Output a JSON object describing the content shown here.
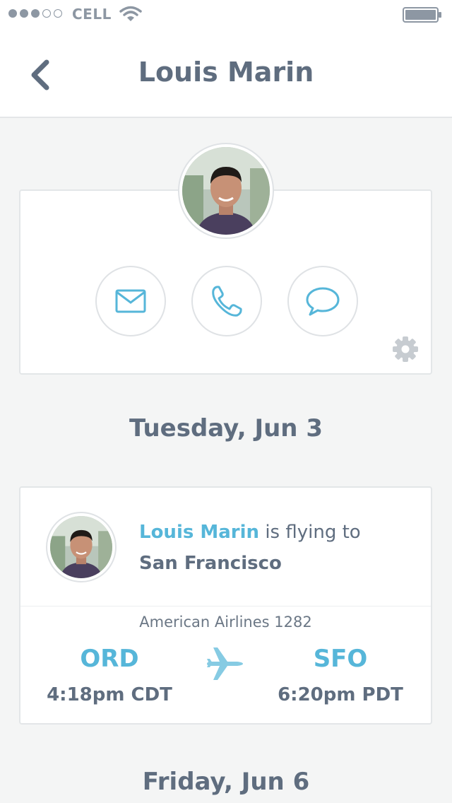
{
  "status_bar": {
    "carrier": "CELL",
    "signal_bars_filled": 3,
    "signal_bars_total": 5
  },
  "nav": {
    "title": "Louis Marin",
    "back_icon": "chevron-left-icon"
  },
  "profile": {
    "actions": [
      {
        "icon": "mail-icon"
      },
      {
        "icon": "phone-icon"
      },
      {
        "icon": "chat-icon"
      }
    ],
    "settings_icon": "gear-icon"
  },
  "days": [
    {
      "heading": "Tuesday, Jun 3",
      "event": {
        "person": "Louis Marin",
        "verb": "is flying to",
        "destination": "San Francisco",
        "airline": "American Airlines 1282",
        "origin_code": "ORD",
        "origin_time": "4:18pm CDT",
        "dest_code": "SFO",
        "dest_time": "6:20pm PDT"
      }
    },
    {
      "heading": "Friday, Jun 6"
    }
  ],
  "colors": {
    "accent": "#56b6d9",
    "text": "#5f6d7f",
    "background": "#f4f5f5"
  }
}
